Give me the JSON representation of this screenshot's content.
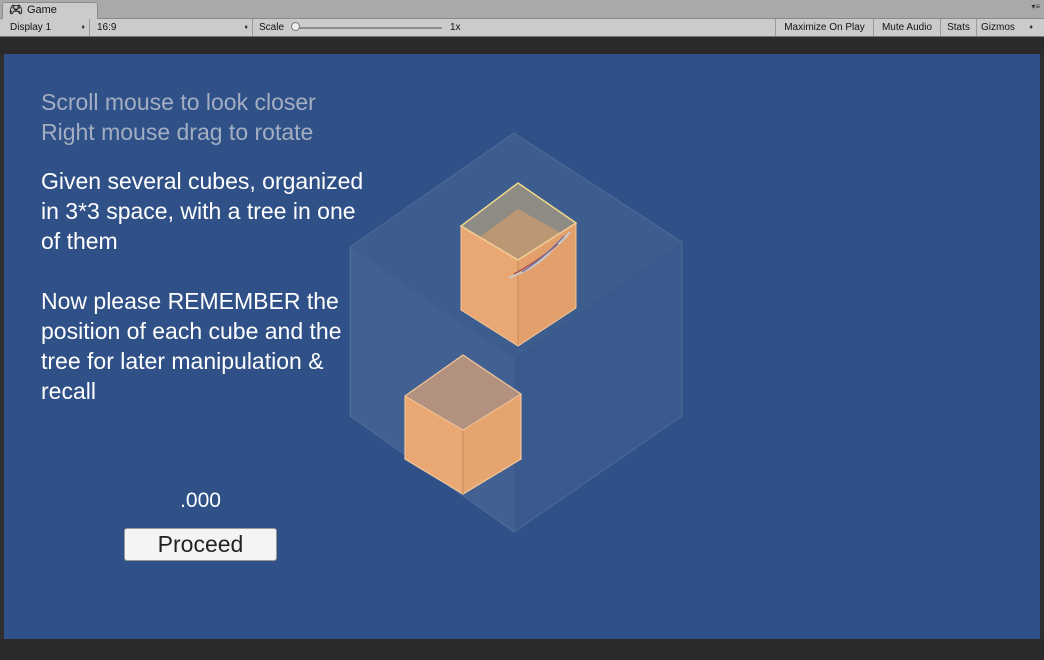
{
  "window": {
    "tab_label": "Game",
    "tab_icon": "unity-game-icon"
  },
  "toolbar": {
    "display_select": "Display 1",
    "aspect_select": "16:9",
    "scale_label": "Scale",
    "scale_value": "1x",
    "maximize_on_play": "Maximize On Play",
    "mute_audio": "Mute Audio",
    "stats": "Stats",
    "gizmos": "Gizmos"
  },
  "game": {
    "hint_lines": [
      "Scroll mouse to look closer",
      "Right mouse drag to rotate"
    ],
    "instructions": [
      "Given several cubes, organized in 3*3 space, with a tree in one of them",
      "Now please REMEMBER the position of each cube and the tree for later manipulation & recall"
    ],
    "timer": ".000",
    "proceed_label": "Proceed"
  },
  "colors": {
    "background": "#305187",
    "cube_fill": "#e9a873",
    "text": "#ffffff",
    "hint_text": "#a3aec2"
  }
}
